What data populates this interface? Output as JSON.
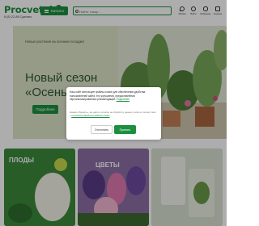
{
  "header": {
    "logo_text": "Procvetok",
    "phone": "8 (8) 22-88 Сделать",
    "catalog_label": "Каталог",
    "search_placeholder": "Найти товар…",
    "icons": [
      {
        "name": "location-icon",
        "label": "Москва"
      },
      {
        "name": "user-icon",
        "label": "Войти"
      },
      {
        "name": "heart-icon",
        "label": "Избранное"
      },
      {
        "name": "cart-icon",
        "label": "Корзина"
      }
    ]
  },
  "hero": {
    "subtitle": "Новые растения на осенние посадки!",
    "title_line1": "Новый сезон",
    "title_line2": "«Осень-2025»",
    "button_label": "Подробнее"
  },
  "cards": {
    "card1_text": "ПЛОДЫ",
    "card2_text": "ЦВЕТЫ",
    "card3_text": ""
  },
  "cookie": {
    "text": "Наш сайт использует файлы cookie для обеспечения удобства пользователей сайта, его улучшения, предоставления персонализированных рекомендаций.",
    "text_link": "Подробнее",
    "note": "Нажав «Принять», вы даёте согласие на обработку данных cookie в соответствии с",
    "note_link": "политикой обработки файлов cookie",
    "decline_label": "Отклонить",
    "accept_label": "Принять"
  },
  "colors": {
    "brand_green": "#1c8f3f",
    "hero_bg": "#dfe6cc"
  }
}
